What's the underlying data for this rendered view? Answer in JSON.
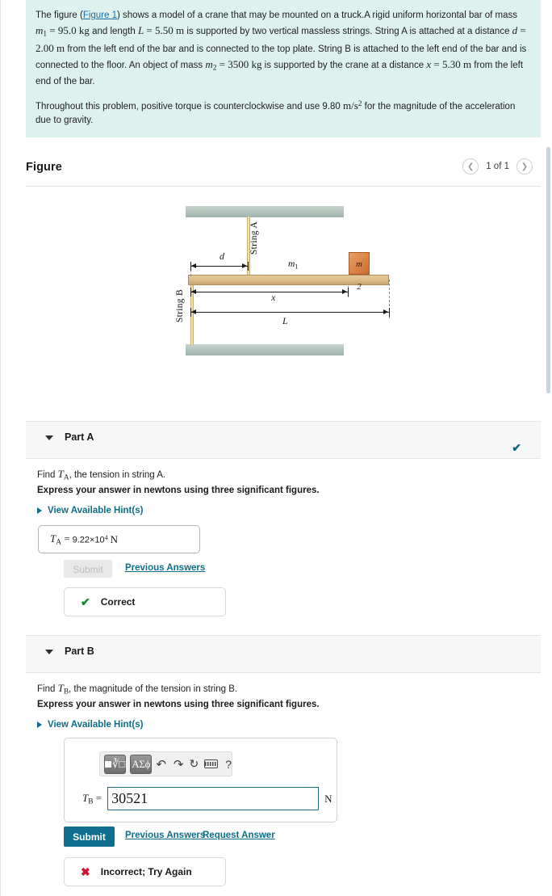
{
  "problem": {
    "paragraph1_pre": "The figure (",
    "figure_link": "Figure 1",
    "paragraph1_mid": ") shows a model of a crane that may be mounted on a truck.A rigid uniform horizontal bar of mass ",
    "m1_symbol": "m",
    "m1_sub": "1",
    "m1_value": "= 95.0 kg",
    "text_length": "and length",
    "L_symbol": "L",
    "L_value": "= 5.50 m",
    "text_supported": "is supported by two vertical massless strings. String A is attached at a distance",
    "d_symbol": "d",
    "d_value": "= 2.00 m",
    "text_from_left": "from the left end of the bar and is connected to the top plate. String B is attached to the left end of the bar and is connected to the floor. An object of mass",
    "m2_symbol": "m",
    "m2_sub": "2",
    "m2_value": "= 3500 kg",
    "text_supported2": "is supported by the crane at a distance",
    "x_symbol": "x",
    "x_value": "= 5.30 m",
    "text_end": "from the left end of the bar.",
    "paragraph2_pre": "Throughout this problem, positive torque is counterclockwise and use 9.80 ",
    "gravity_units": "m/s",
    "gravity_exp": "2",
    "paragraph2_post": " for the magnitude of the acceleration due to gravity."
  },
  "figure_section": {
    "title": "Figure",
    "counter": "1 of 1",
    "prev_icon": "chevron-left-icon",
    "next_icon": "chevron-right-icon"
  },
  "diagram": {
    "string_a_label": "String A",
    "string_b_label": "String B",
    "bar_mass_label": "m",
    "bar_mass_sub": "1",
    "block_label": "m",
    "block_sub": "2",
    "dim_d": "d",
    "dim_x": "x",
    "dim_L": "L",
    "colors": {
      "plate": "#b6c6bf",
      "bar": "#dcba85",
      "string": "#fdf3c8",
      "block": "#dd8548"
    }
  },
  "part_a": {
    "title": "Part A",
    "status_icon": "check-icon",
    "question_pre": "Find ",
    "question_symbol": "T",
    "question_sub": "A",
    "question_post": ", the tension in string A.",
    "instruction": "Express your answer in newtons using three significant figures.",
    "hint_label": "View Available Hint(s)",
    "answer_symbol": "T",
    "answer_sub": "A",
    "answer_eq": "=",
    "answer_value": "9.22×10",
    "answer_exp": "4",
    "answer_unit": "N",
    "submit_label": "Submit",
    "previous_answers_label": "Previous Answers",
    "feedback_icon": "check-icon",
    "feedback_text": "Correct"
  },
  "part_b": {
    "title": "Part B",
    "question_pre": "Find ",
    "question_symbol": "T",
    "question_sub": "B",
    "question_post": ", the magnitude of the tension in string B.",
    "instruction": "Express your answer in newtons using three significant figures.",
    "hint_label": "View Available Hint(s)",
    "toolbar": {
      "template_button": "template-icon",
      "greek_button": "ΑΣϕ",
      "undo_icon": "undo-arrow-icon",
      "redo_icon": "redo-arrow-icon",
      "reset_icon": "reset-circular-arrow-icon",
      "keyboard_icon": "keyboard-icon",
      "help_icon": "?"
    },
    "field_symbol": "T",
    "field_sub": "B",
    "field_eq": "=",
    "input_value": "30521",
    "input_placeholder": "",
    "field_unit": "N",
    "submit_label": "Submit",
    "previous_answers_label": "Previous Answers",
    "request_answer_label": "Request Answer",
    "feedback_icon": "x-icon",
    "feedback_text": "Incorrect; Try Again"
  }
}
